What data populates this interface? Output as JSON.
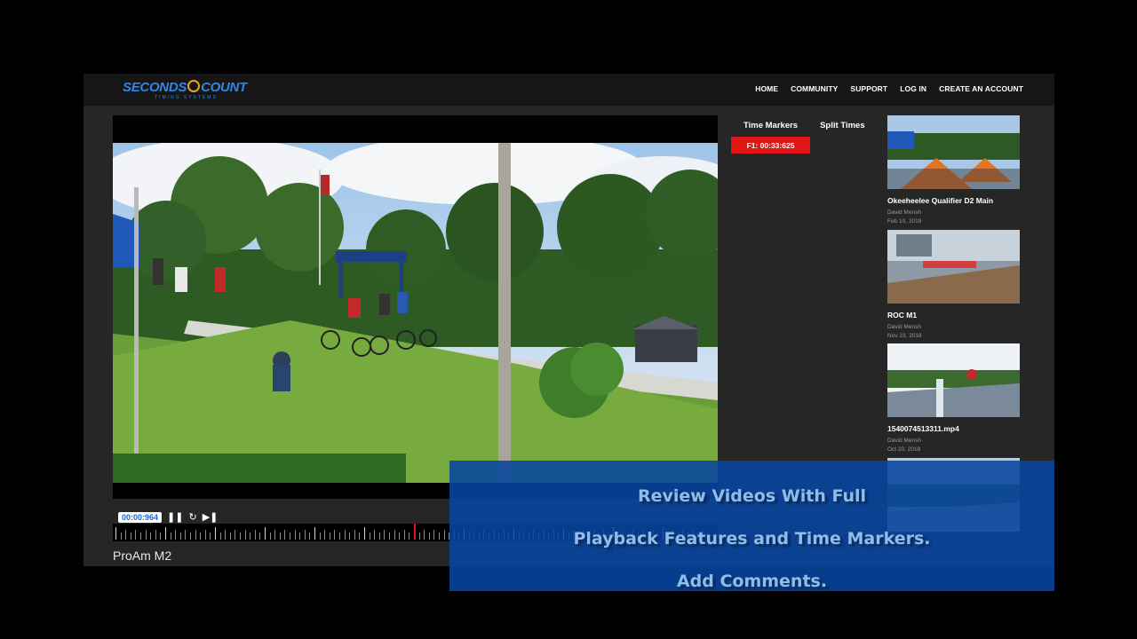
{
  "brand": {
    "logo_left": "SECONDS",
    "logo_right": "COUNT",
    "tagline": "TIMING SYSTEMS"
  },
  "nav": {
    "home": "HOME",
    "community": "COMMUNITY",
    "support": "SUPPORT",
    "login": "LOG IN",
    "create_account": "CREATE AN ACCOUNT"
  },
  "player": {
    "current_time": "00:00:964",
    "pause_icon": "pause-icon",
    "replay_icon": "replay-icon",
    "next_icon": "skip-next-icon",
    "video_title": "ProAm M2"
  },
  "side_tabs": {
    "time_markers": "Time Markers",
    "split_times": "Split Times"
  },
  "markers": [
    {
      "label": "F1: 00:33:625"
    }
  ],
  "videos": [
    {
      "title": "Okeeheelee Qualifier D2 Main",
      "author": "David Mensh",
      "date": "Feb 10, 2019"
    },
    {
      "title": "ROC M1",
      "author": "David Mensh",
      "date": "Nov 23, 2018"
    },
    {
      "title": "1540074513311.mp4",
      "author": "David Mensh",
      "date": "Oct 20, 2018"
    }
  ],
  "overlay": {
    "line1": "Review Videos With Full",
    "line2": "Playback Features and Time Markers.",
    "line3": "Add Comments."
  },
  "colors": {
    "accent_red": "#e01616",
    "brand_blue": "#2f86e8",
    "overlay_blue": "#0846a0"
  }
}
